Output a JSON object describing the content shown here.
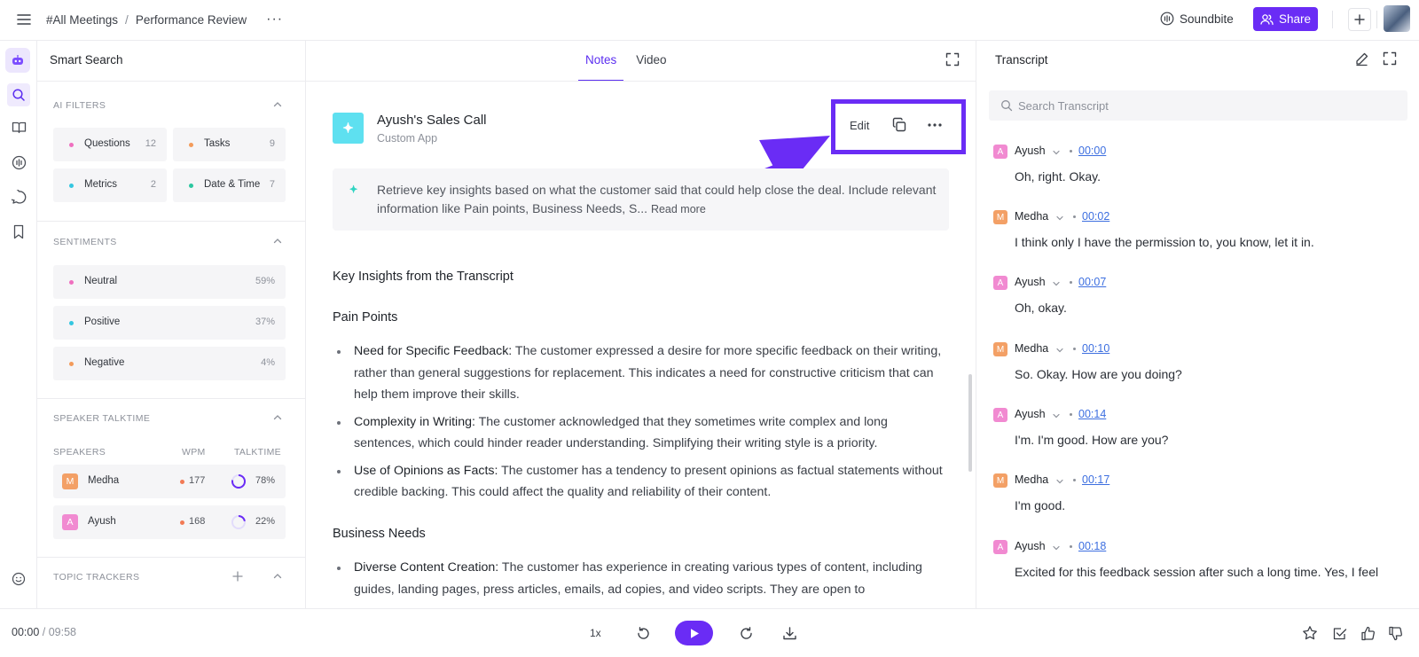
{
  "header": {
    "breadcrumb_root": "#All Meetings",
    "breadcrumb_sep": "/",
    "breadcrumb_page": "Performance Review",
    "more_glyph": "···",
    "soundbite_label": "Soundbite",
    "share_label": "Share",
    "accent_color": "#6a2cf5"
  },
  "rail": {
    "icons": [
      "bot-icon",
      "search-icon",
      "book-icon",
      "soundwave-icon",
      "chat-icon",
      "bookmark-icon",
      "smiley-icon"
    ]
  },
  "smart_search": {
    "title": "Smart Search",
    "ai_filters": {
      "heading": "AI FILTERS",
      "chips": [
        {
          "label": "Questions",
          "count": "12",
          "color": "#ef6fbf"
        },
        {
          "label": "Tasks",
          "count": "9",
          "color": "#f39b5a"
        },
        {
          "label": "Metrics",
          "count": "2",
          "color": "#34c6e0"
        },
        {
          "label": "Date & Time",
          "count": "7",
          "color": "#2bc7a0"
        }
      ]
    },
    "sentiments": {
      "heading": "SENTIMENTS",
      "rows": [
        {
          "label": "Neutral",
          "pct": "59%",
          "color": "#ef6fbf"
        },
        {
          "label": "Positive",
          "pct": "37%",
          "color": "#34c6e0"
        },
        {
          "label": "Negative",
          "pct": "4%",
          "color": "#f39b5a"
        }
      ]
    },
    "talktime": {
      "heading": "SPEAKER TALKTIME",
      "col_speakers": "SPEAKERS",
      "col_wpm": "WPM",
      "col_talktime": "TALKTIME",
      "speakers": [
        {
          "initial": "M",
          "name": "Medha",
          "wpm": "177",
          "talktime": "78%",
          "talktime_fraction": 0.78,
          "color": "#f3a066"
        },
        {
          "initial": "A",
          "name": "Ayush",
          "wpm": "168",
          "talktime": "22%",
          "talktime_fraction": 0.22,
          "color": "#f18ad1"
        }
      ]
    },
    "topic_trackers": {
      "heading": "TOPIC TRACKERS"
    }
  },
  "main": {
    "tabs": [
      {
        "label": "Notes"
      },
      {
        "label": "Video"
      }
    ],
    "app_name": "Ayush's Sales Call",
    "app_sub": "Custom App",
    "actions": {
      "edit_label": "Edit"
    },
    "prompt_text": "Retrieve key insights based on what the customer said that could help close the deal. Include relevant information like Pain points, Business Needs, S...",
    "prompt_read_more": "Read more",
    "doc": {
      "title": "Key Insights from the Transcript",
      "pain_heading": "Pain Points",
      "pain_points": [
        {
          "term": "Need for Specific Feedback:",
          "text": " The customer expressed a desire for more specific feedback on their writing, rather than general suggestions for replacement. This indicates a need for constructive criticism that can help them improve their skills."
        },
        {
          "term": "Complexity in Writing:",
          "text": " The customer acknowledged that they sometimes write complex and long sentences, which could hinder reader understanding. Simplifying their writing style is a priority."
        },
        {
          "term": "Use of Opinions as Facts:",
          "text": " The customer has a tendency to present opinions as factual statements without credible backing. This could affect the quality and reliability of their content."
        }
      ],
      "needs_heading": "Business Needs",
      "business_needs": [
        {
          "term": "Diverse Content Creation:",
          "text": " The customer has experience in creating various types of content, including guides, landing pages, press articles, emails, ad copies, and video scripts. They are open to"
        }
      ]
    }
  },
  "transcript": {
    "title": "Transcript",
    "search_placeholder": "Search Transcript",
    "entries": [
      {
        "initial": "A",
        "speaker": "Ayush",
        "time": "00:00",
        "text": "Oh, right. Okay.",
        "color": "#f18ad1"
      },
      {
        "initial": "M",
        "speaker": "Medha",
        "time": "00:02",
        "text": "I think only I have the permission to, you know, let it in.",
        "color": "#f3a066"
      },
      {
        "initial": "A",
        "speaker": "Ayush",
        "time": "00:07",
        "text": "Oh, okay.",
        "color": "#f18ad1"
      },
      {
        "initial": "M",
        "speaker": "Medha",
        "time": "00:10",
        "text": "So. Okay. How are you doing?",
        "color": "#f3a066"
      },
      {
        "initial": "A",
        "speaker": "Ayush",
        "time": "00:14",
        "text": "I'm. I'm good. How are you?",
        "color": "#f18ad1"
      },
      {
        "initial": "M",
        "speaker": "Medha",
        "time": "00:17",
        "text": "I'm good.",
        "color": "#f3a066"
      },
      {
        "initial": "A",
        "speaker": "Ayush",
        "time": "00:18",
        "text": "Excited for this feedback session after such a long time. Yes, I feel",
        "color": "#f18ad1"
      }
    ]
  },
  "player": {
    "current_time": "00:00",
    "time_sep": " / ",
    "total_time": "09:58",
    "speed": "1x"
  }
}
